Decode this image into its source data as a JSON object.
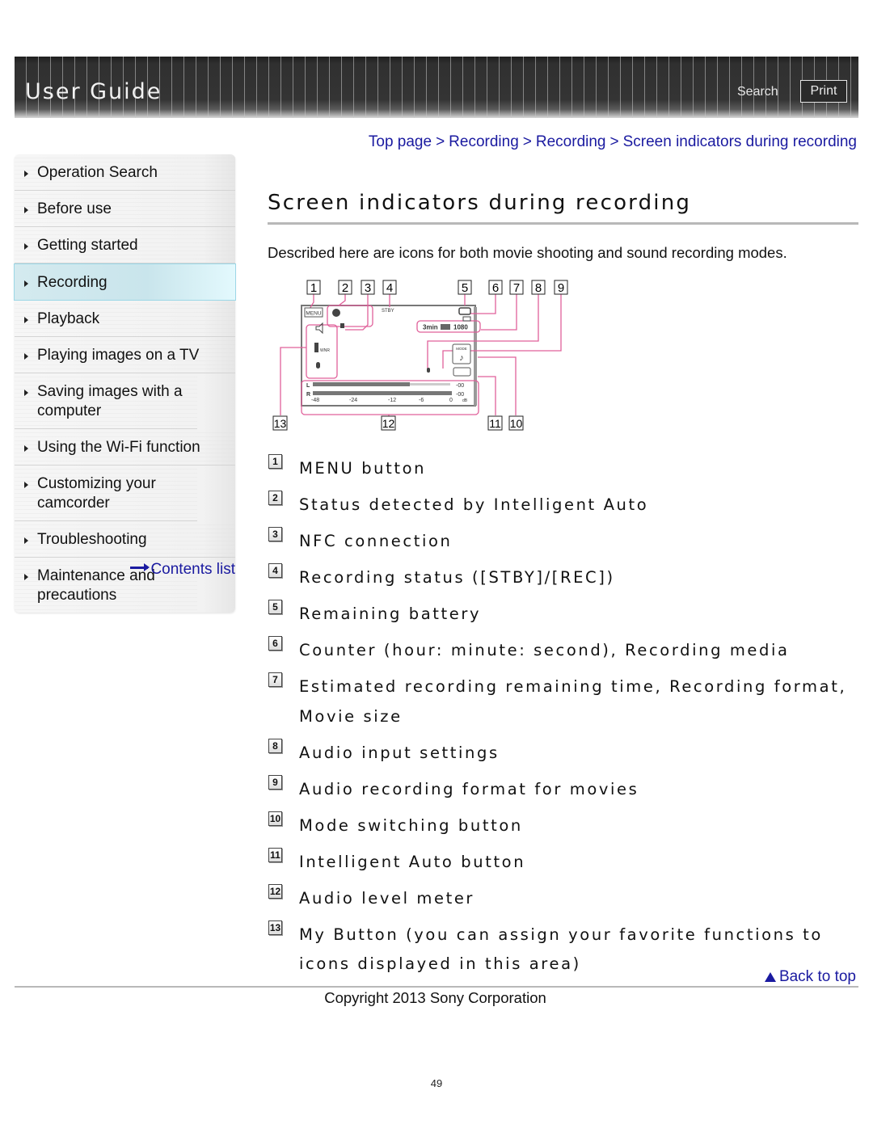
{
  "header": {
    "title": "User Guide",
    "search_label": "Search",
    "print_label": "Print"
  },
  "breadcrumb": [
    {
      "label": "Top page"
    },
    {
      "label": "Recording"
    },
    {
      "label": "Recording"
    },
    {
      "label": "Screen indicators during recording"
    }
  ],
  "breadcrumb_separator": ">",
  "sidebar": {
    "items": [
      {
        "label": "Operation Search",
        "active": false
      },
      {
        "label": "Before use",
        "active": false
      },
      {
        "label": "Getting started",
        "active": false
      },
      {
        "label": "Recording",
        "active": true
      },
      {
        "label": "Playback",
        "active": false
      },
      {
        "label": "Playing images on a TV",
        "active": false
      },
      {
        "label": "Saving images with a computer",
        "active": false
      },
      {
        "label": "Using the Wi-Fi function",
        "active": false
      },
      {
        "label": "Customizing your camcorder",
        "active": false
      },
      {
        "label": "Troubleshooting",
        "active": false
      },
      {
        "label": "Maintenance and precautions",
        "active": false
      }
    ],
    "contents_link": "Contents list"
  },
  "main": {
    "title": "Screen indicators during recording",
    "intro": "Described here are icons for both movie shooting and sound recording modes.",
    "diagram": {
      "callouts": [
        "1",
        "2",
        "3",
        "4",
        "5",
        "6",
        "7",
        "8",
        "9",
        "10",
        "11",
        "12",
        "13"
      ],
      "screen_labels": {
        "menu": "MENU",
        "status": "STBY",
        "remaining": "3min",
        "size": "1080",
        "mode": "MODE",
        "audio_format": "♪",
        "channel_left": "L",
        "channel_right": "R",
        "meter_scale": [
          "-48",
          "-24",
          "-12",
          "-6",
          "0",
          "dB"
        ],
        "peak_left": "-00",
        "peak_right": "-00",
        "wind": "WNR"
      }
    },
    "legend": [
      {
        "num": "1",
        "text": "MENU button"
      },
      {
        "num": "2",
        "text": "Status detected by Intelligent Auto"
      },
      {
        "num": "3",
        "text": "NFC connection"
      },
      {
        "num": "4",
        "text": "Recording status ([STBY]/[REC])"
      },
      {
        "num": "5",
        "text": "Remaining battery"
      },
      {
        "num": "6",
        "text": "Counter (hour: minute: second), Recording media"
      },
      {
        "num": "7",
        "text": "Estimated recording remaining time, Recording format, Movie size"
      },
      {
        "num": "8",
        "text": "Audio input settings"
      },
      {
        "num": "9",
        "text": "Audio recording format for movies"
      },
      {
        "num": "10",
        "text": "Mode switching button"
      },
      {
        "num": "11",
        "text": "Intelligent Auto button"
      },
      {
        "num": "12",
        "text": "Audio level meter"
      },
      {
        "num": "13",
        "text": "My Button (you can assign your favorite functions to icons displayed in this area)"
      }
    ]
  },
  "footer": {
    "back_to_top": "Back to top",
    "copyright": "Copyright 2013 Sony Corporation",
    "page_number": "49"
  },
  "colors": {
    "link": "#1a1aa0",
    "callout_line": "#e0609a",
    "active_nav": "#c9e5ec",
    "banner": "#333333"
  }
}
